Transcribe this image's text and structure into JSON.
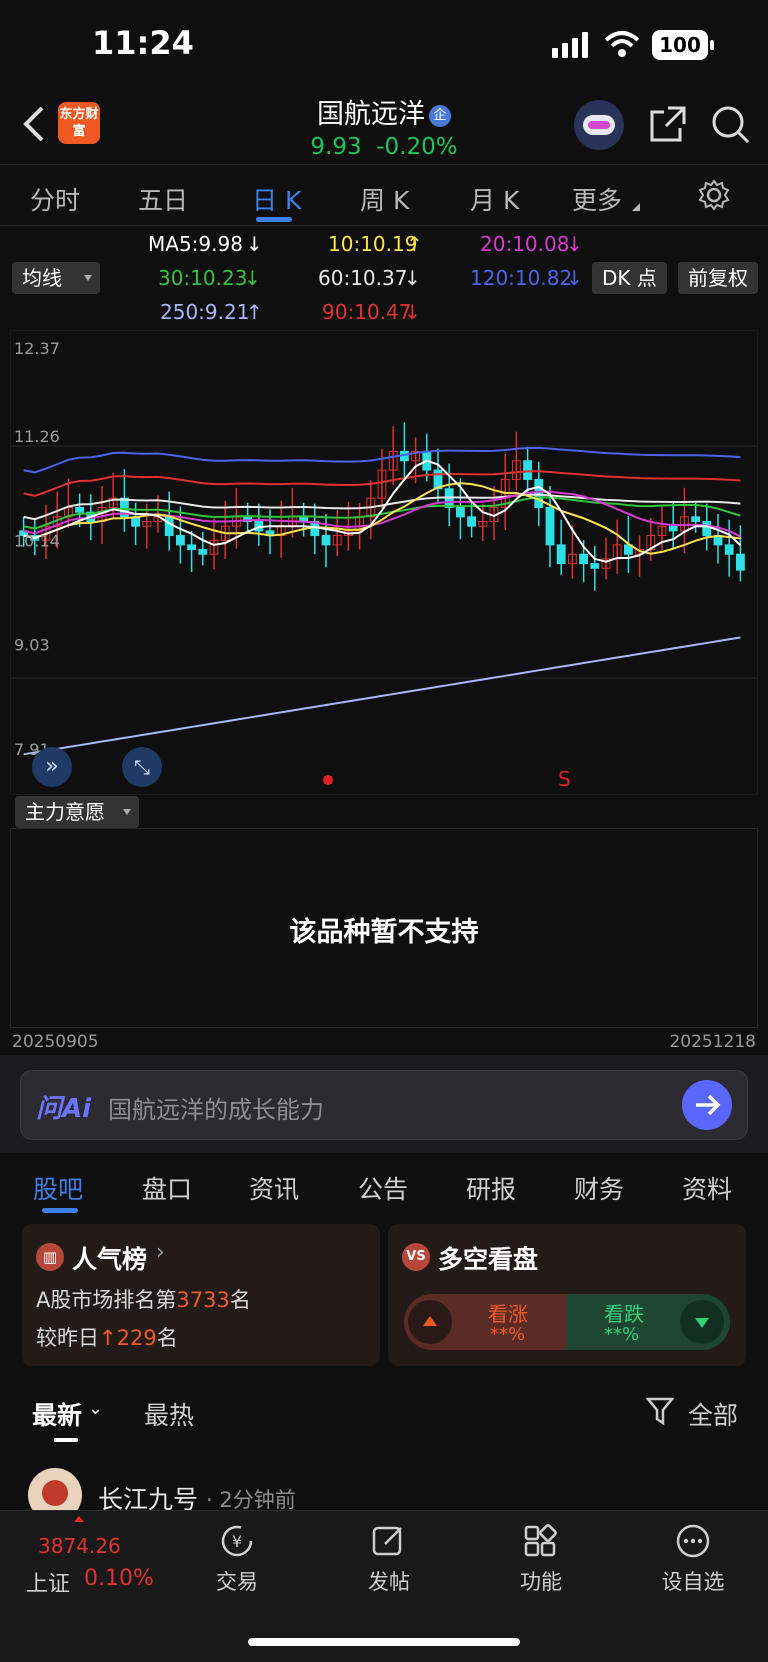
{
  "status": {
    "time": "11:24",
    "battery": "100"
  },
  "header": {
    "logo": "东方财富",
    "stock_name": "国航远洋",
    "price": "9.93",
    "change": "-0.20%"
  },
  "period_tabs": [
    "分时",
    "五日",
    "日 K",
    "周 K",
    "月 K",
    "更多"
  ],
  "indicator_select": "均线",
  "ma": {
    "ma5": "MA5:9.98",
    "ma10": "10:10.19",
    "ma20": "20:10.08",
    "ma30": "30:10.23",
    "ma60": "60:10.37",
    "ma120": "120:10.82",
    "ma250": "250:9.21",
    "ma90": "90:10.47"
  },
  "buttons": {
    "dk": "DK 点",
    "adjust": "前复权"
  },
  "chart_data": {
    "type": "candlestick",
    "y_labels": [
      "12.37",
      "11.26",
      "10.14",
      "9.03",
      "7.91"
    ],
    "x_start": "20250905",
    "x_end": "20251218",
    "signal_marker": "S",
    "closes": [
      10.3,
      10.25,
      10.4,
      10.5,
      10.6,
      10.55,
      10.45,
      10.6,
      10.7,
      10.5,
      10.4,
      10.45,
      10.5,
      10.3,
      10.2,
      10.15,
      10.1,
      10.25,
      10.4,
      10.5,
      10.45,
      10.35,
      10.3,
      10.4,
      10.5,
      10.45,
      10.3,
      10.2,
      10.3,
      10.35,
      10.5,
      10.7,
      11.0,
      11.2,
      11.1,
      11.2,
      11.0,
      10.8,
      10.6,
      10.5,
      10.4,
      10.45,
      10.6,
      10.9,
      11.1,
      10.9,
      10.6,
      10.2,
      10.0,
      10.1,
      10.0,
      9.95,
      10.05,
      10.2,
      10.1,
      10.15,
      10.3,
      10.4,
      10.35,
      10.5,
      10.45,
      10.3,
      10.2,
      10.1,
      9.93
    ]
  },
  "sub_indicator": "主力意愿",
  "unsupported": "该品种暂不支持",
  "ai": {
    "logo": "问Ai",
    "query": "国航远洋的成长能力"
  },
  "lower_tabs": [
    "股吧",
    "盘口",
    "资讯",
    "公告",
    "研报",
    "财务",
    "资料"
  ],
  "popularity": {
    "title": "人气榜",
    "rank_prefix": "A股市场排名第",
    "rank": "3733",
    "rank_suffix": "名",
    "delta_prefix": "较昨日",
    "delta": "229",
    "delta_suffix": "名"
  },
  "vote": {
    "title": "多空看盘",
    "up": "看涨",
    "up_pct": "**%",
    "down": "看跌",
    "down_pct": "**%"
  },
  "feed": {
    "latest": "最新",
    "hot": "最热",
    "filter": "全部"
  },
  "post": {
    "author": "长江九号",
    "time": "· 2分钟前"
  },
  "bottom_nav": {
    "index_value": "3874.26",
    "index_name": "上证",
    "index_change": "0.10%",
    "trade": "交易",
    "post": "发帖",
    "functions": "功能",
    "watchlist": "设自选"
  }
}
